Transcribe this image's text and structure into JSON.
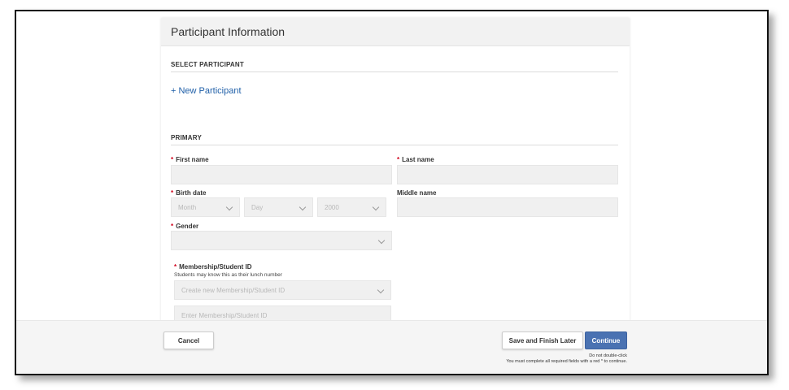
{
  "card": {
    "title": "Participant Information"
  },
  "select_participant": {
    "heading": "SELECT PARTICIPANT",
    "new_participant_link": "+ New Participant"
  },
  "primary": {
    "heading": "PRIMARY",
    "first_name_label": "First name",
    "last_name_label": "Last name",
    "birth_date_label": "Birth date",
    "birth_month_value": "Month",
    "birth_day_value": "Day",
    "birth_year_value": "2000",
    "middle_name_label": "Middle name",
    "gender_label": "Gender",
    "membership_label": "Membership/Student ID",
    "membership_helper": "Students may know this as their lunch number",
    "membership_select_value": "Create new Membership/Student ID",
    "membership_input_placeholder": "Enter Membership/Student ID",
    "required_marker": "*"
  },
  "footer": {
    "cancel_label": "Cancel",
    "save_label": "Save and Finish Later",
    "continue_label": "Continue",
    "note_line1": "Do not double-click",
    "note_line2": "You must complete all required fields with a red * to continue."
  },
  "colors": {
    "link": "#1f5fa8",
    "required": "#d0021b",
    "primary_button": "#4a72b2"
  },
  "icons": [
    "chevron-down-icon"
  ]
}
